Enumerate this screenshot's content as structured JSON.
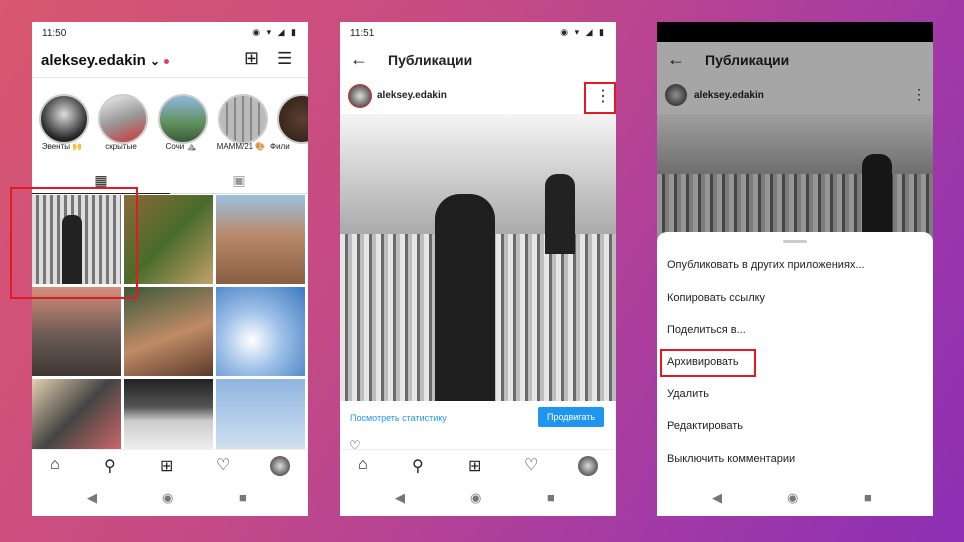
{
  "phone1": {
    "time": "11:50",
    "status_icons": "◉ ▾ ◢ ▮",
    "username": "aleksey.edakin",
    "stories": [
      {
        "label": "Эвенты 🙌"
      },
      {
        "label": "скрытые"
      },
      {
        "label": "Сочи ⛰️"
      },
      {
        "label": "MAMM/21 🎨"
      },
      {
        "label": "Фили"
      }
    ]
  },
  "phone2": {
    "time": "11:51",
    "status_icons": "◉ ▾ ◢ ▮",
    "title": "Публикации",
    "username": "aleksey.edakin",
    "insights": "Посмотреть статистику",
    "promote": "Продвигать"
  },
  "phone3": {
    "title": "Публикации",
    "username": "aleksey.edakin",
    "menu": [
      "Опубликовать в других приложениях...",
      "Копировать ссылку",
      "Поделиться в...",
      "Архивировать",
      "Удалить",
      "Редактировать",
      "Выключить комментарии"
    ]
  },
  "icons": {
    "back": "←",
    "more": "⋮",
    "menu": "☰",
    "plus": "⊞",
    "grid": "▦",
    "tag": "▣",
    "home": "⌂",
    "search": "⚲",
    "add": "⊞",
    "heart": "♡",
    "nav_back": "◀",
    "nav_home": "◉",
    "nav_recent": "■",
    "chevron": "⌄"
  },
  "colors": {
    "accent": "#1f95f0",
    "highlight": "#e21b23",
    "notif": "#e0405a"
  }
}
